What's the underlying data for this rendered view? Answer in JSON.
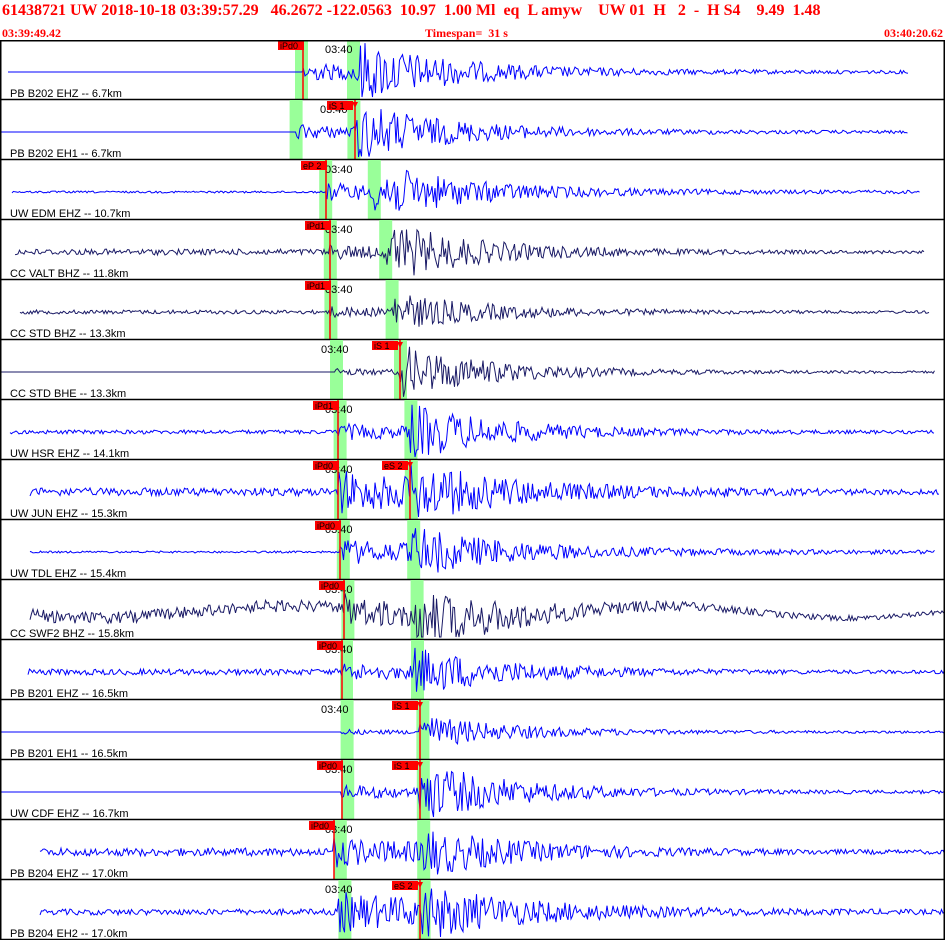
{
  "header": {
    "title": "61438721 UW 2018-10-18 03:39:57.29   46.2672 -122.0563  10.97  1.00 Ml  eq  L amyw    UW 01  H   2  -  H S4    9.49  1.48",
    "start_time": "03:39:49.42",
    "timespan": "Timespan=  31 s",
    "end_time": "03:40:20.62"
  },
  "colors": {
    "trace_blue": "#0000ff",
    "trace_navy": "#1a1a66",
    "pick_red": "#ff0000",
    "phase_window_green": "#99ff99",
    "divider": "#000000",
    "header_text": "#ff0000"
  },
  "time_tick_label": "03:40",
  "traces": [
    {
      "label": "PB B202 EHZ -- 6.7km",
      "color": "blue",
      "p_pick": "iPd0",
      "s_pick": ""
    },
    {
      "label": "PB B202 EH1 -- 6.7km",
      "color": "blue",
      "p_pick": "",
      "s_pick": "iS 1"
    },
    {
      "label": "UW EDM EHZ -- 10.7km",
      "color": "blue",
      "p_pick": "eP 2",
      "s_pick": ""
    },
    {
      "label": "CC VALT BHZ -- 11.8km",
      "color": "navy",
      "p_pick": "iPd1",
      "s_pick": ""
    },
    {
      "label": "CC STD BHZ -- 13.3km",
      "color": "navy",
      "p_pick": "iPd1",
      "s_pick": ""
    },
    {
      "label": "CC STD BHE -- 13.3km",
      "color": "navy",
      "p_pick": "",
      "s_pick": "iS 1"
    },
    {
      "label": "UW HSR EHZ -- 14.1km",
      "color": "blue",
      "p_pick": "iPd1",
      "s_pick": ""
    },
    {
      "label": "UW JUN EHZ -- 15.3km",
      "color": "blue",
      "p_pick": "iPd0",
      "s_pick": "eS 2"
    },
    {
      "label": "UW TDL EHZ -- 15.4km",
      "color": "blue",
      "p_pick": "iPd0",
      "s_pick": ""
    },
    {
      "label": "CC SWF2 BHZ -- 15.8km",
      "color": "navy",
      "p_pick": "iPd0",
      "s_pick": ""
    },
    {
      "label": "PB B201 EHZ -- 16.5km",
      "color": "blue",
      "p_pick": "iPd0",
      "s_pick": ""
    },
    {
      "label": "PB B201 EH1 -- 16.5km",
      "color": "blue",
      "p_pick": "",
      "s_pick": "iS 1"
    },
    {
      "label": "UW CDF EHZ -- 16.7km",
      "color": "blue",
      "p_pick": "iPd0",
      "s_pick": "iS 1"
    },
    {
      "label": "PB B204 EHZ -- 17.0km",
      "color": "blue",
      "p_pick": "iPd0",
      "s_pick": ""
    },
    {
      "label": "PB B204 EH2 -- 17.0km",
      "color": "blue",
      "p_pick": "",
      "s_pick": "eS 2"
    }
  ]
}
